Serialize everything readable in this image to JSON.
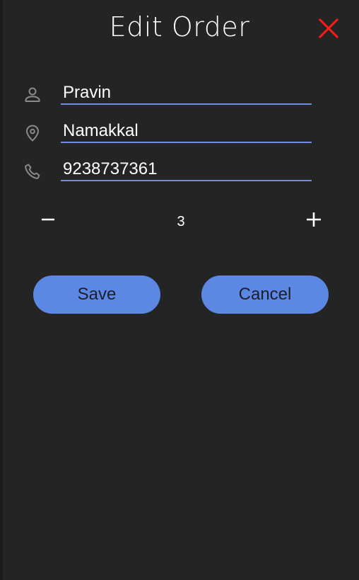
{
  "header": {
    "title": "Edit Order",
    "close_icon": "close-icon"
  },
  "form": {
    "name": {
      "icon": "person-icon",
      "value": "Pravin"
    },
    "location": {
      "icon": "location-pin-icon",
      "value": "Namakkal"
    },
    "phone": {
      "icon": "phone-icon",
      "value": "9238737361"
    }
  },
  "quantity": {
    "decrement_icon": "minus-icon",
    "value": "3",
    "increment_icon": "plus-icon"
  },
  "actions": {
    "save_label": "Save",
    "cancel_label": "Cancel"
  },
  "colors": {
    "background": "#242424",
    "accent": "#5c87e2",
    "underline": "#6f8fe6",
    "close": "#ff1a1a",
    "text": "#ffffff",
    "icon": "#8a8a8a"
  }
}
